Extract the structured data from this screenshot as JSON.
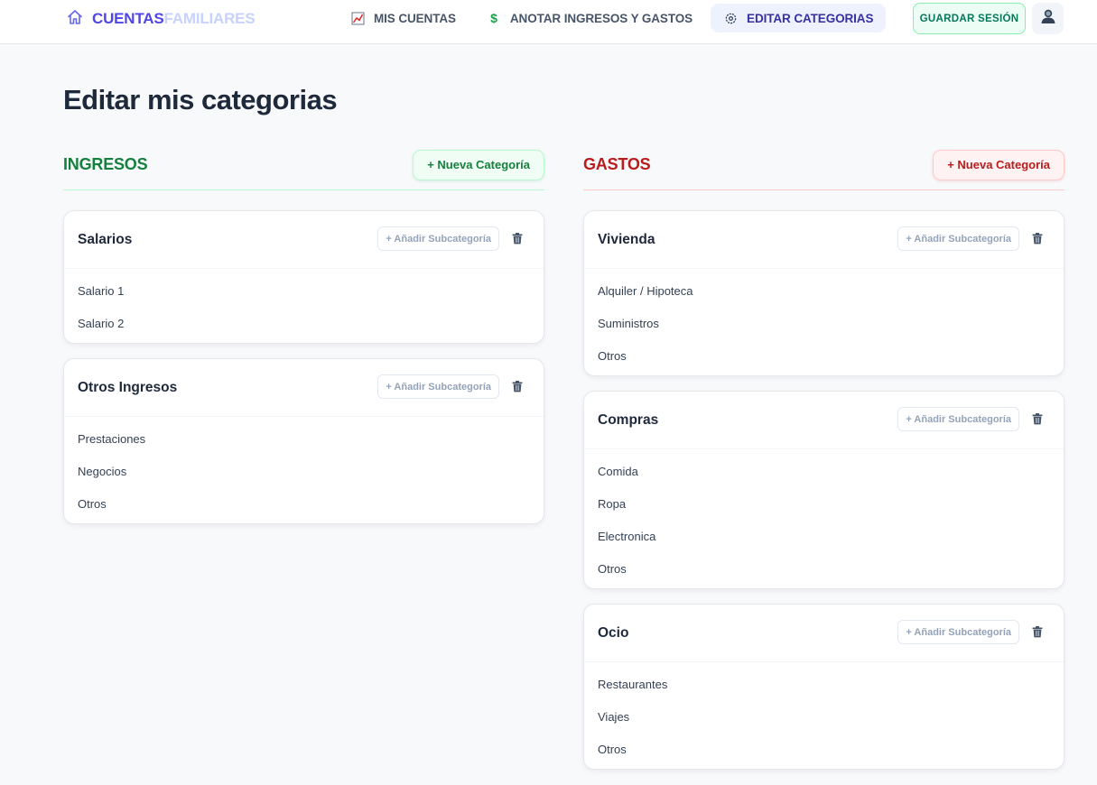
{
  "header": {
    "logo_part1": "CUENTAS",
    "logo_part2": "FAMILIARES",
    "nav": [
      {
        "label": "MIS CUENTAS",
        "icon": "chart-icon",
        "active": false
      },
      {
        "label": "ANOTAR INGRESOS Y GASTOS",
        "icon": "dollar-icon",
        "active": false
      },
      {
        "label": "EDITAR CATEGORIAS",
        "icon": "gear-icon",
        "active": true
      }
    ],
    "save_label": "GUARDAR SESIÓN",
    "avatar_icon": "user-icon"
  },
  "page": {
    "title": "Editar mis categorias"
  },
  "ingresos": {
    "title": "INGRESOS",
    "new_label": "+ Nueva Categoría",
    "color": "#15803d",
    "categories": [
      {
        "name": "Salarios",
        "subs": [
          "Salario 1",
          "Salario 2"
        ]
      },
      {
        "name": "Otros Ingresos",
        "subs": [
          "Prestaciones",
          "Negocios",
          "Otros"
        ]
      }
    ]
  },
  "gastos": {
    "title": "GASTOS",
    "new_label": "+ Nueva Categoría",
    "color": "#b91c1c",
    "categories": [
      {
        "name": "Vivienda",
        "subs": [
          "Alquiler / Hipoteca",
          "Suministros",
          "Otros"
        ]
      },
      {
        "name": "Compras",
        "subs": [
          "Comida",
          "Ropa",
          "Electronica",
          "Otros"
        ]
      },
      {
        "name": "Ocio",
        "subs": [
          "Restaurantes",
          "Viajes",
          "Otros"
        ]
      }
    ]
  },
  "card": {
    "add_sub_label": "+ Añadir Subcategoría",
    "delete_icon": "trash-icon"
  }
}
